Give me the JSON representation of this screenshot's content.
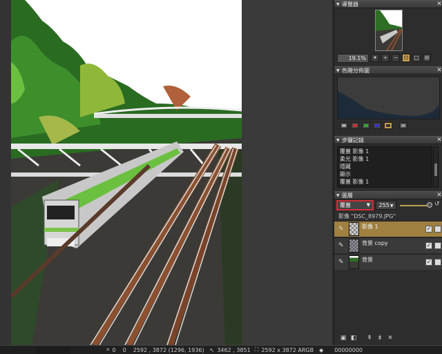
{
  "navigator": {
    "title": "導覽器",
    "zoom": "19.1%"
  },
  "histogram": {
    "title": "色階分佈圖"
  },
  "history": {
    "title": "步驟記錄",
    "items": [
      "覆蓋 影像 1",
      "柔光 影像 1",
      "隱藏",
      "顯示",
      "覆蓋 影像 1"
    ]
  },
  "layers": {
    "title": "圖層",
    "blend_mode": "覆蓋",
    "opacity": "255",
    "file_label": "影像 \"DSC_8979.JPG\"",
    "rows": [
      {
        "name": "影像 1",
        "selected": true
      },
      {
        "name": "背景 copy",
        "selected": false
      },
      {
        "name": "背景",
        "selected": false
      }
    ]
  },
  "status": {
    "pos1": "0",
    "pos2": "0",
    "coords": "2592 , 3872 (1296, 1936)",
    "cursor": "3462 , 3851",
    "size": "2592 x 3872 ARGB",
    "color": "00000000"
  },
  "colors": {
    "accent": "#c8a050",
    "selected_layer": "#a08040",
    "highlight_border": "#d0303a"
  }
}
